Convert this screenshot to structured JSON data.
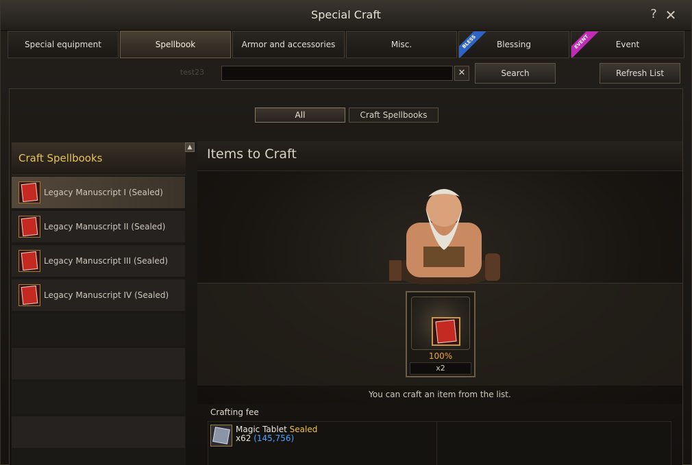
{
  "window": {
    "title": "Special Craft",
    "help": "?",
    "close": "✕"
  },
  "tabs": [
    {
      "label": "Special equipment",
      "active": false
    },
    {
      "label": "Spellbook",
      "active": true
    },
    {
      "label": "Armor and accessories",
      "active": false
    },
    {
      "label": "Misc.",
      "active": false
    },
    {
      "label": "Blessing",
      "active": false,
      "ribbon": "BLESS"
    },
    {
      "label": "Event",
      "active": false,
      "ribbon": "EVENT"
    }
  ],
  "search": {
    "ghost_text": "test23",
    "value": "",
    "clear_label": "✕",
    "search_label": "Search",
    "refresh_label": "Refresh List"
  },
  "filters": [
    {
      "label": "All",
      "active": true
    },
    {
      "label": "Craft Spellbooks",
      "active": false
    }
  ],
  "list": {
    "header": "Craft Spellbooks",
    "scroll_up": "▲",
    "items": [
      {
        "label": "Legacy Manuscript I (Sealed)",
        "selected": true
      },
      {
        "label": "Legacy Manuscript II (Sealed)",
        "selected": false
      },
      {
        "label": "Legacy Manuscript III (Sealed)",
        "selected": false
      },
      {
        "label": "Legacy Manuscript IV (Sealed)",
        "selected": false
      }
    ]
  },
  "craft": {
    "title": "Items to Craft",
    "success_rate": "100%",
    "quantity": "x2",
    "hint": "You can craft an item from the list."
  },
  "fee": {
    "label": "Crafting fee",
    "material_name": "Magic Tablet",
    "material_tag": "Sealed",
    "material_qty": "x62",
    "material_owned": "(145,756)"
  },
  "colors": {
    "header_gold": "#e7c35a",
    "percent_orange": "#f0a531",
    "owned_blue": "#4aa3ff",
    "bless_ribbon": "#2f63c8",
    "event_ribbon": "#c12bb6"
  }
}
